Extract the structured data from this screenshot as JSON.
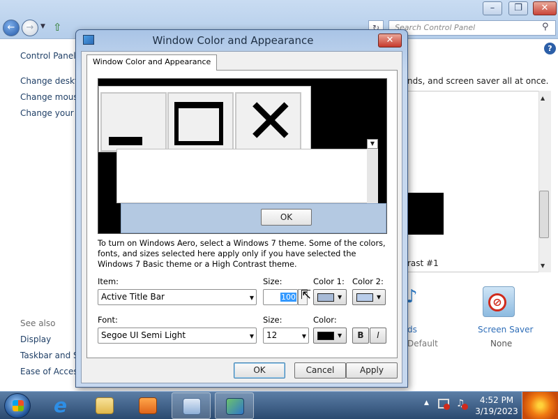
{
  "explorer": {
    "search_placeholder": "Search Control Panel",
    "left_pane": {
      "title": "Control Panel H",
      "links": [
        "Change deskto",
        "Change mouse",
        "Change your lo"
      ],
      "see_also_header": "See also",
      "see_also": [
        "Display",
        "Taskbar and Sta",
        "Ease of Access"
      ]
    },
    "right": {
      "desc_text": "nds, and screen saver all at once.",
      "theme_caption": "rast #1",
      "sounds_label": "ds",
      "sounds_sub": "Default",
      "saver_label": "Screen Saver",
      "saver_sub": "None"
    }
  },
  "dialog": {
    "title": "Window Color and Appearance",
    "tab_label": "Window Color and Appearance",
    "preview_ok": "OK",
    "info_text": "To turn on Windows Aero, select a Windows 7 theme.  Some of the colors, fonts, and sizes selected here apply only if you have selected the Windows 7 Basic theme or a High Contrast theme.",
    "item_label": "Item:",
    "item_value": "Active Title Bar",
    "size_label": "Size:",
    "size_value": "100",
    "color1_label": "Color 1:",
    "color2_label": "Color 2:",
    "color1": "#a7bad6",
    "color2": "#b9cdea",
    "font_label": "Font:",
    "font_value": "Segoe UI Semi Light",
    "font_size_label": "Size:",
    "font_size_value": "12",
    "font_color_label": "Color:",
    "font_color": "#000000",
    "bold_label": "B",
    "italic_label": "I",
    "ok_label": "OK",
    "cancel_label": "Cancel",
    "apply_label": "Apply"
  },
  "taskbar": {
    "time": "4:52 PM",
    "date": "3/19/2023",
    "items": [
      "internet-explorer",
      "windows-explorer",
      "media-player",
      "control-panel",
      "window-color-and-appearance"
    ]
  }
}
